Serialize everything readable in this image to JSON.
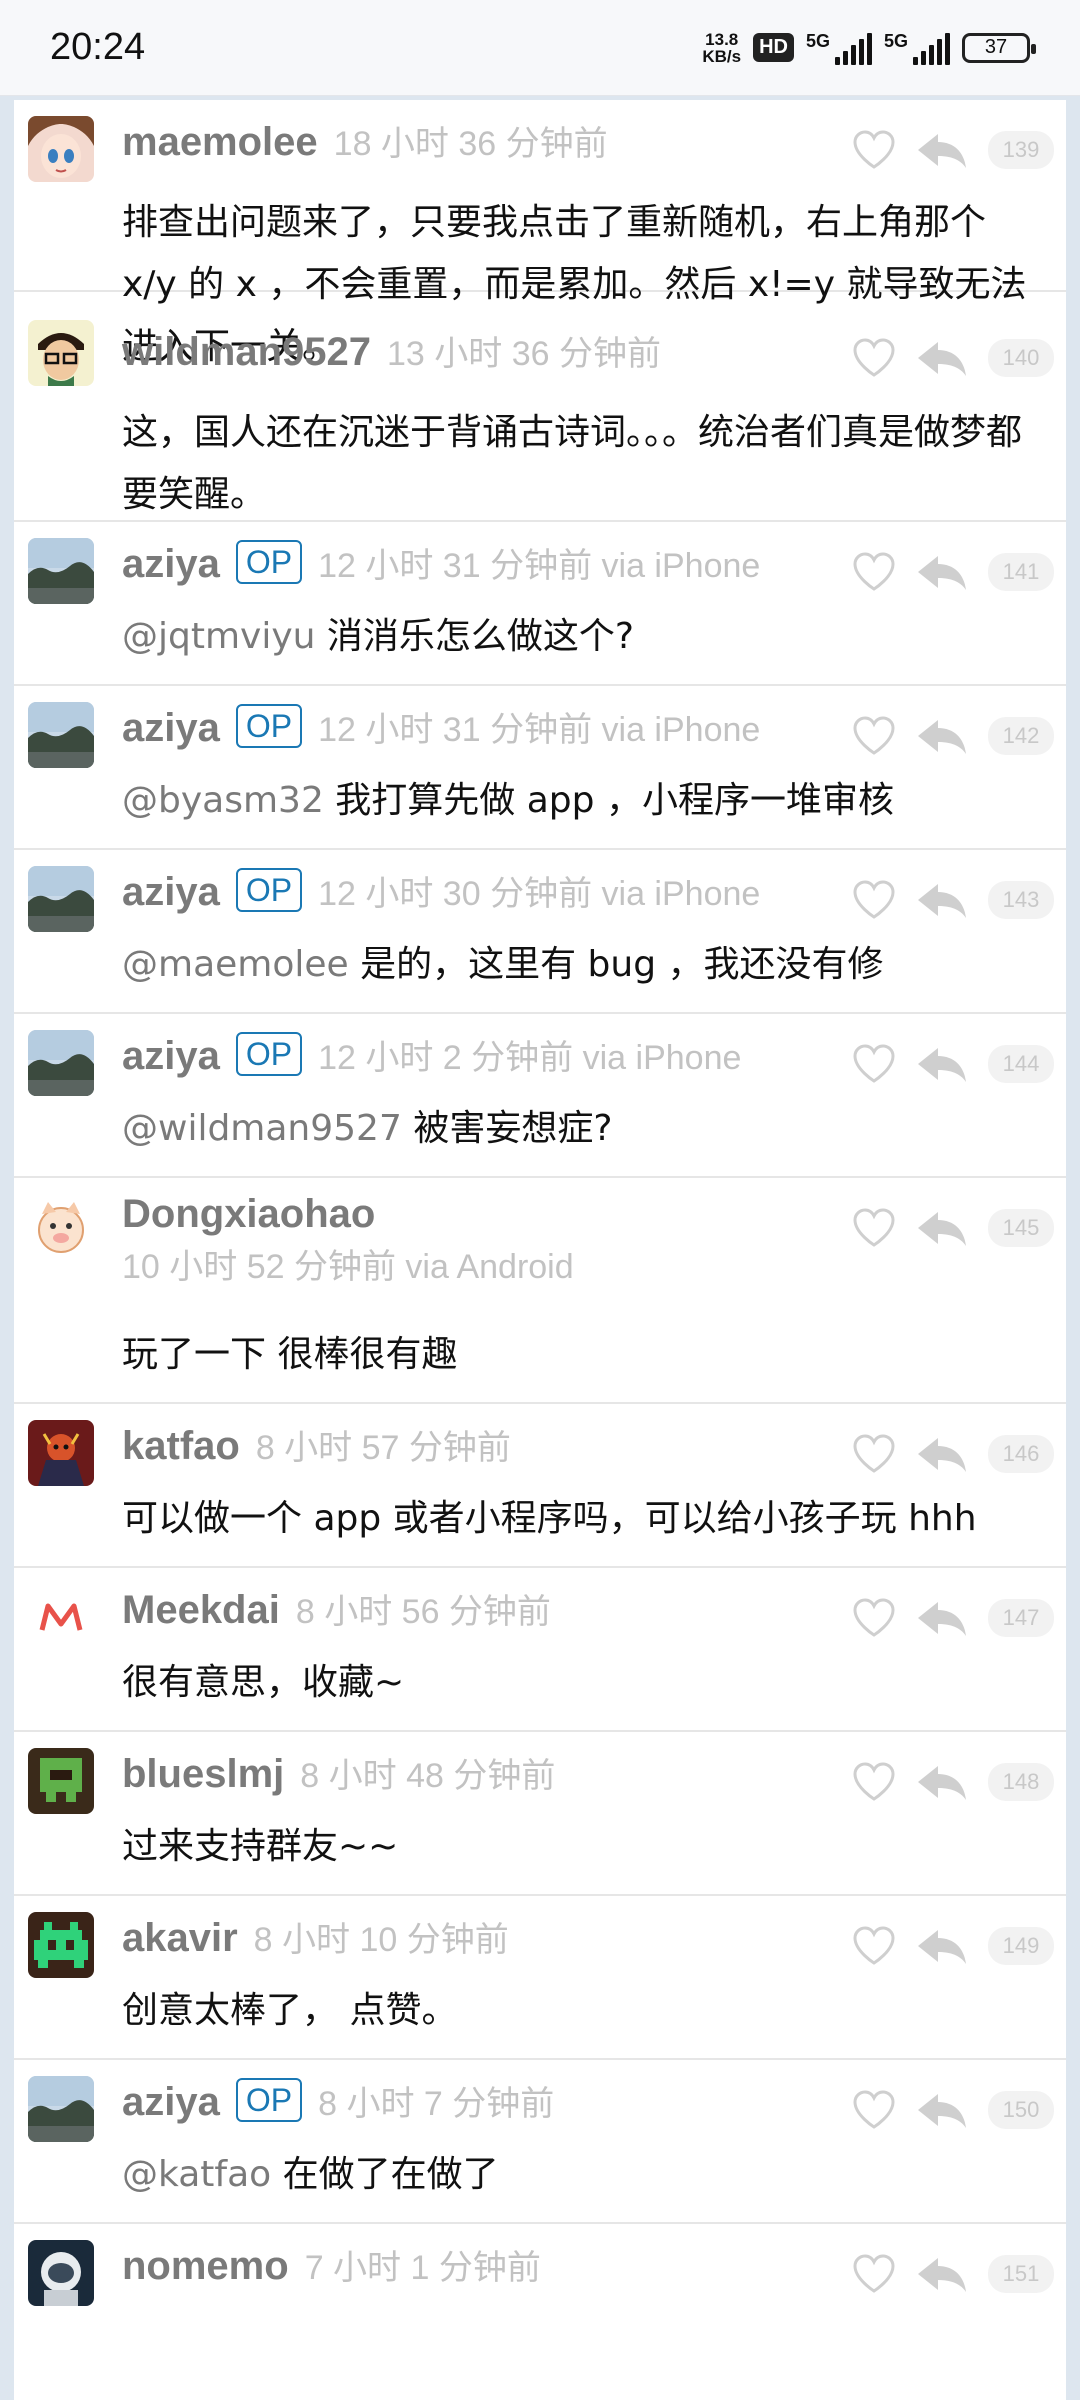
{
  "status_bar": {
    "time": "20:24",
    "net_speed_value": "13.8",
    "net_speed_unit": "KB/s",
    "hd_label": "HD",
    "sim1_label": "5G",
    "sim2_label": "5G",
    "battery": "37"
  },
  "replies": [
    {
      "username": "maemolee",
      "op": false,
      "time": "18 小时 36 分钟前",
      "mention": "",
      "text": "排查出问题来了，只要我点击了重新随机，右上角那个 x/y 的 x ，不会重置，而是累加。然后 x!=y 就导致无法进入下一关。",
      "floor": "139",
      "avatar": "anime-girl"
    },
    {
      "username": "wildman9527",
      "op": false,
      "time": "13 小时 36 分钟前",
      "mention": "",
      "text": "这，国人还在沉迷于背诵古诗词。。。统治者们真是做梦都要笑醒。",
      "floor": "140",
      "avatar": "glasses-man"
    },
    {
      "username": "aziya",
      "op": true,
      "op_label": "OP",
      "time": "12 小时 31 分钟前 via iPhone",
      "mention": "@jqtmviyu",
      "text": " 消消乐怎么做这个?",
      "floor": "141",
      "avatar": "landscape"
    },
    {
      "username": "aziya",
      "op": true,
      "op_label": "OP",
      "time": "12 小时 31 分钟前 via iPhone",
      "mention": "@byasm32",
      "text": " 我打算先做 app ，小程序一堆审核",
      "floor": "142",
      "avatar": "landscape"
    },
    {
      "username": "aziya",
      "op": true,
      "op_label": "OP",
      "time": "12 小时 30 分钟前 via iPhone",
      "mention": "@maemolee",
      "text": " 是的，这里有 bug ，我还没有修",
      "floor": "143",
      "avatar": "landscape"
    },
    {
      "username": "aziya",
      "op": true,
      "op_label": "OP",
      "time": "12 小时 2 分钟前 via iPhone",
      "mention": "@wildman9527",
      "text": " 被害妄想症?",
      "floor": "144",
      "avatar": "landscape"
    },
    {
      "username": "Dongxiaohao",
      "op": false,
      "time": "10 小时 52 分钟前 via Android",
      "mention": "",
      "text": "玩了一下 很棒很有趣",
      "floor": "145",
      "avatar": "pig"
    },
    {
      "username": "katfao",
      "op": false,
      "time": "8 小时 57 分钟前",
      "mention": "",
      "text": "可以做一个 app 或者小程序吗，可以给小孩子玩 hhh",
      "floor": "146",
      "avatar": "comic"
    },
    {
      "username": "Meekdai",
      "op": false,
      "time": "8 小时 56 分钟前",
      "mention": "",
      "text": "很有意思，收藏~",
      "floor": "147",
      "avatar": "m-logo"
    },
    {
      "username": "blueslmj",
      "op": false,
      "time": "8 小时 48 分钟前",
      "mention": "",
      "text": "过来支持群友~~",
      "floor": "148",
      "avatar": "pixel-green"
    },
    {
      "username": "akavir",
      "op": false,
      "time": "8 小时 10 分钟前",
      "mention": "",
      "text": "创意太棒了， 点赞。",
      "floor": "149",
      "avatar": "invader"
    },
    {
      "username": "aziya",
      "op": true,
      "op_label": "OP",
      "time": "8 小时 7 分钟前",
      "mention": "@katfao",
      "text": " 在做了在做了",
      "floor": "150",
      "avatar": "landscape"
    },
    {
      "username": "nomemo",
      "op": false,
      "time": "7 小时 1 分钟前",
      "mention": "",
      "text": "",
      "floor": "151",
      "avatar": "astronaut"
    }
  ],
  "icons": {
    "like": "heart-icon",
    "reply": "reply-arrow-icon"
  },
  "colors": {
    "op_badge": "#1a78b4",
    "username": "#7a7a7a",
    "timestamp": "#c2c2c2",
    "page_bg": "#dde6ef"
  }
}
